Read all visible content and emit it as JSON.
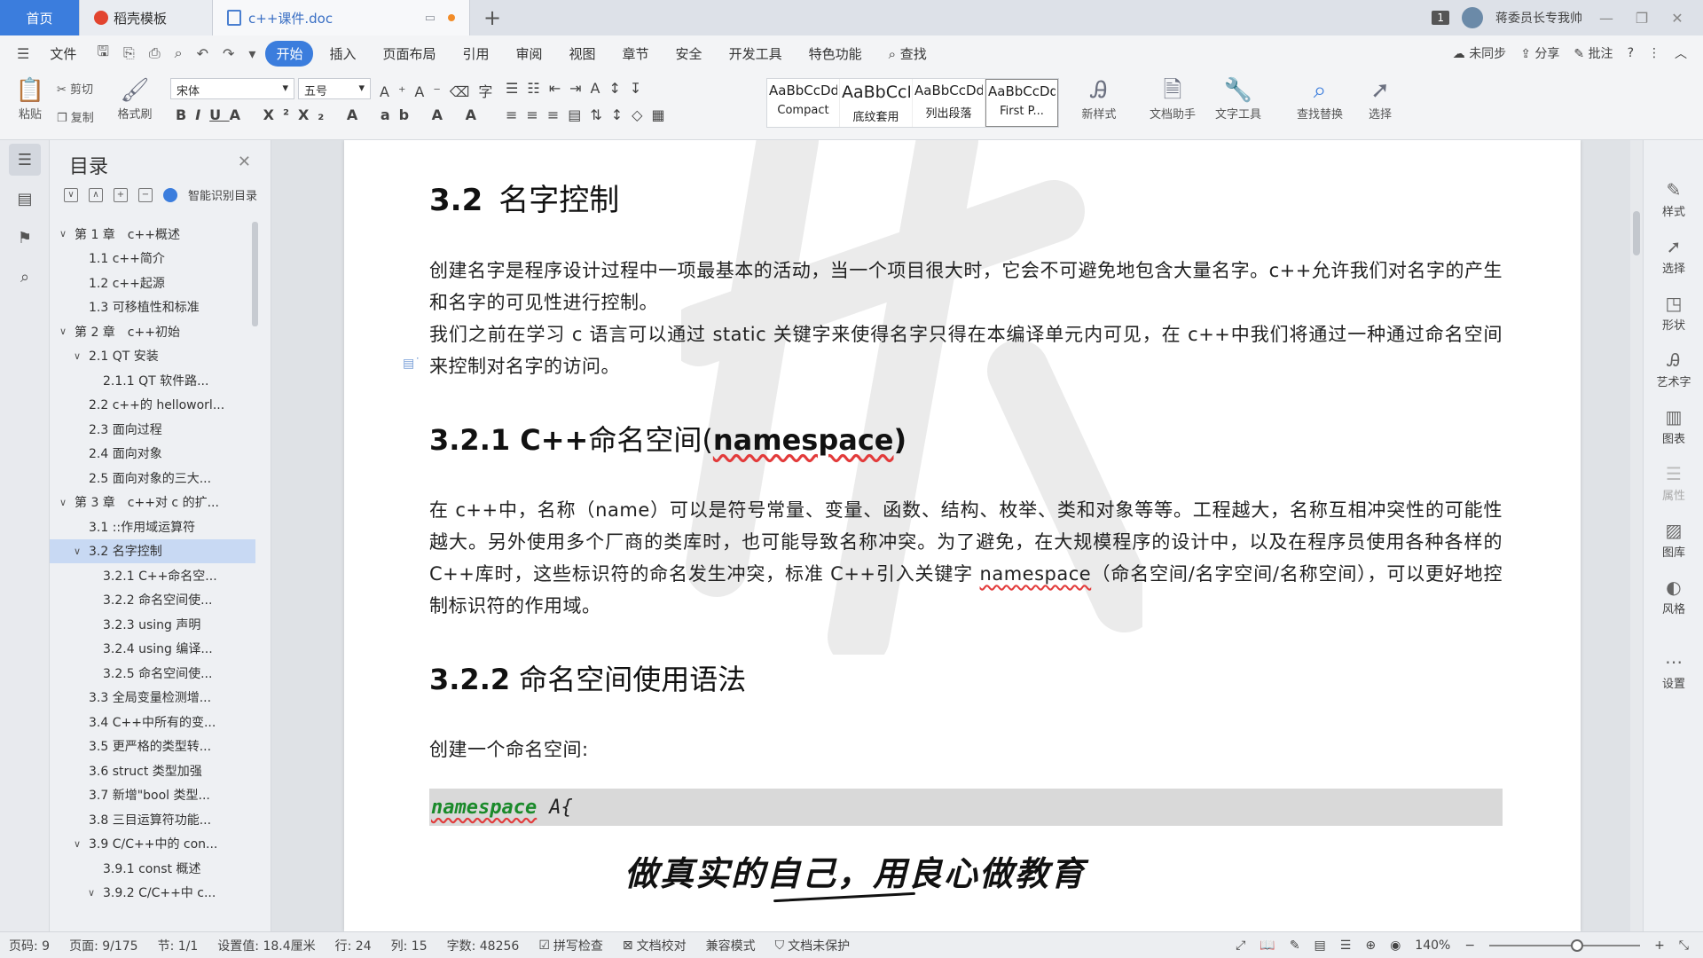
{
  "titlebar": {
    "tabs": [
      "首页",
      "稻壳模板",
      "c++课件.doc"
    ],
    "badge": "1",
    "user": "蒋委员长专我帅"
  },
  "menu": {
    "file": "文件",
    "items": [
      "开始",
      "插入",
      "页面布局",
      "引用",
      "审阅",
      "视图",
      "章节",
      "安全",
      "开发工具",
      "特色功能"
    ],
    "search": "查找",
    "right": [
      "未同步",
      "分享",
      "批注"
    ]
  },
  "ribbon": {
    "paste": "粘贴",
    "cut": "剪切",
    "copy": "复制",
    "format_painter": "格式刷",
    "font_name": "宋体",
    "font_size": "五号",
    "styles": [
      {
        "preview": "AaBbCcDd",
        "name": "Compact"
      },
      {
        "preview": "AaBbCcI",
        "name": "底纹套用"
      },
      {
        "preview": "AaBbCcDd",
        "name": "列出段落"
      },
      {
        "preview": "AaBbCcDd",
        "name": "First P..."
      }
    ],
    "new_style": "新样式",
    "doc_assistant": "文档助手",
    "text_tools": "文字工具",
    "find_replace": "查找替换",
    "select": "选择"
  },
  "toc": {
    "title": "目录",
    "smart": "智能识别目录",
    "items": [
      {
        "label": "第 1 章　c++概述",
        "level": 0,
        "exp": true
      },
      {
        "label": "1.1 c++简介",
        "level": 1
      },
      {
        "label": "1.2 c++起源",
        "level": 1
      },
      {
        "label": "1.3 可移植性和标准",
        "level": 1
      },
      {
        "label": "第 2 章　c++初始",
        "level": 0,
        "exp": true
      },
      {
        "label": "2.1 QT 安装",
        "level": 1,
        "exp": true
      },
      {
        "label": "2.1.1 QT 软件路...",
        "level": 2
      },
      {
        "label": "2.2 c++的 helloworl...",
        "level": 1
      },
      {
        "label": "2.3 面向过程",
        "level": 1
      },
      {
        "label": "2.4 面向对象",
        "level": 1
      },
      {
        "label": "2.5 面向对象的三大...",
        "level": 1
      },
      {
        "label": "第 3 章　c++对 c 的扩...",
        "level": 0,
        "exp": true
      },
      {
        "label": "3.1 ::作用域运算符",
        "level": 1
      },
      {
        "label": "3.2 名字控制",
        "level": 1,
        "exp": true,
        "selected": true
      },
      {
        "label": "3.2.1 C++命名空...",
        "level": 2
      },
      {
        "label": "3.2.2 命名空间使...",
        "level": 2
      },
      {
        "label": "3.2.3 using 声明",
        "level": 2
      },
      {
        "label": "3.2.4 using 编译...",
        "level": 2
      },
      {
        "label": "3.2.5 命名空间使...",
        "level": 2
      },
      {
        "label": "3.3 全局变量检测增...",
        "level": 1
      },
      {
        "label": "3.4 C++中所有的变...",
        "level": 1
      },
      {
        "label": "3.5 更严格的类型转...",
        "level": 1
      },
      {
        "label": "3.6 struct 类型加强",
        "level": 1
      },
      {
        "label": "3.7 新增\"bool 类型...",
        "level": 1
      },
      {
        "label": "3.8 三目运算符功能...",
        "level": 1
      },
      {
        "label": "3.9 C/C++中的 con...",
        "level": 1,
        "exp": true
      },
      {
        "label": "3.9.1 const 概述",
        "level": 2
      },
      {
        "label": "3.9.2 C/C++中 c...",
        "level": 2,
        "exp": true
      }
    ]
  },
  "doc": {
    "h_32_num": "3.2",
    "h_32_text": "名字控制",
    "p1": "创建名字是程序设计过程中一项最基本的活动，当一个项目很大时，它会不可避免地包含大量名字。c++允许我们对名字的产生和名字的可见性进行控制。",
    "p2": "我们之前在学习 c 语言可以通过 static 关键字来使得名字只得在本编译单元内可见，在 c++中我们将通过一种通过命名空间来控制对名字的访问。",
    "h_321_num": "3.2.1 C++",
    "h_321_text": "命名空间(",
    "h_321_word": "namespace",
    "h_321_end": ")",
    "p3a": "在 c++中，名称（name）可以是符号常量、变量、函数、结构、枚举、类和对象等等。工程越大，名称互相冲突性的可能性越大。另外使用多个厂商的类库时，也可能导致名称冲突。为了避免，在大规模程序的设计中，以及在程序员使用各种各样的 C++库时，这些标识符的命名发生冲突，标准 C++引入关键字 ",
    "p3_kw": "namespace",
    "p3b": "（命名空间/名字空间/名称空间），可以更好地控制标识符的作用域。",
    "h_322_num": "3.2.2",
    "h_322_text": "命名空间使用语法",
    "p4": "创建一个命名空间:",
    "code_kw": "namespace",
    "code_rest": "A{",
    "slogan": "做真实的自己，用良心做教育"
  },
  "rightstrip": [
    "样式",
    "选择",
    "形状",
    "艺术字",
    "图表",
    "属性",
    "图库",
    "风格",
    "设置"
  ],
  "status": {
    "page_num": "页码: 9",
    "page": "页面: 9/175",
    "section": "节: 1/1",
    "setting": "设置值: 18.4厘米",
    "row": "行: 24",
    "col": "列: 15",
    "words": "字数: 48256",
    "spell": "拼写检查",
    "proof": "文档校对",
    "compat": "兼容模式",
    "protect": "文档未保护",
    "zoom": "140%"
  }
}
